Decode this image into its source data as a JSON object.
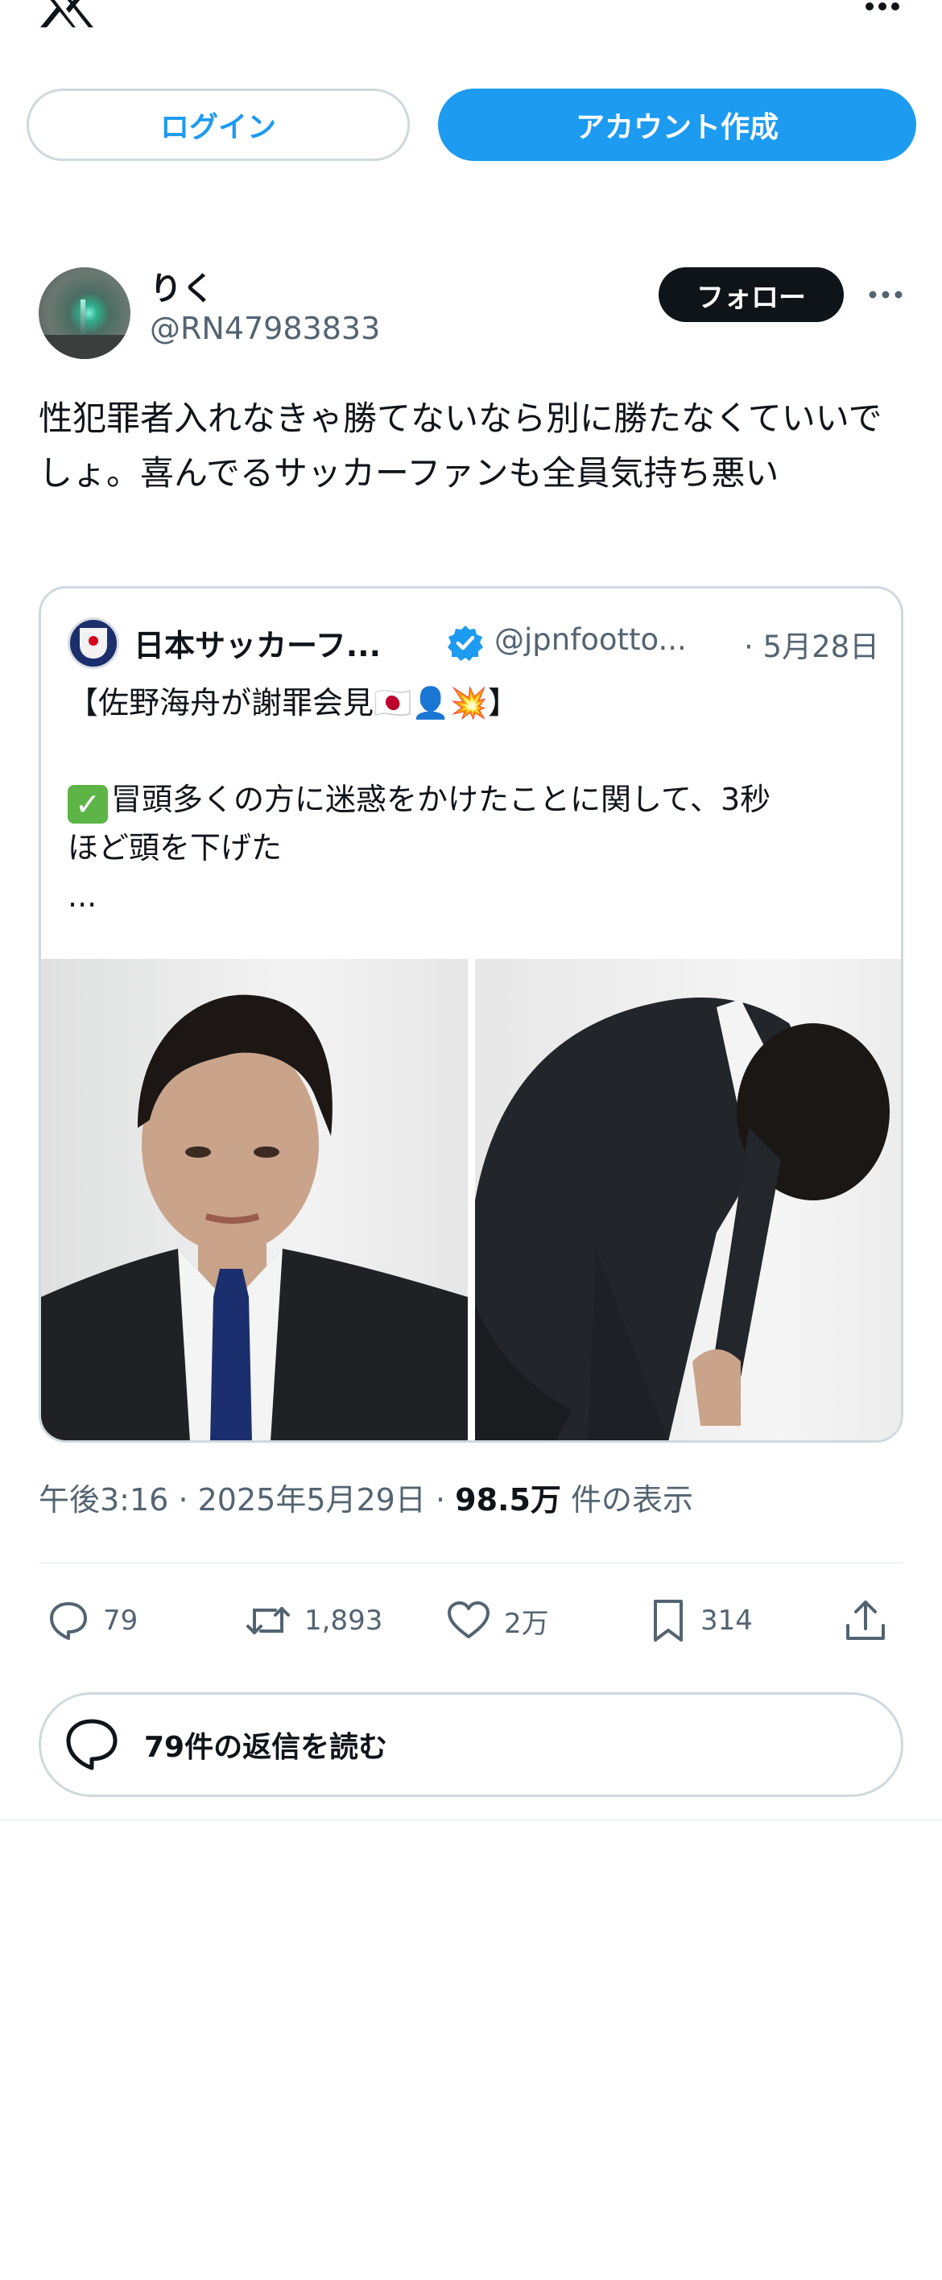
{
  "auth": {
    "login_label": "ログイン",
    "signup_label": "アカウント作成"
  },
  "tweet": {
    "author_name": "りく",
    "author_handle": "@RN47983833",
    "follow_label": "フォロー",
    "text": "性犯罪者入れなきゃ勝てないなら別に勝たなくていいでしょ。喜んでるサッカーファンも全員気持ち悪い",
    "time": "午後3:16",
    "date": "2025年5月29日",
    "views_count": "98.5万",
    "views_label": "件の表示"
  },
  "quote": {
    "author_name": "日本サッカーフ...",
    "author_handle": "@jpnfootto...",
    "date": "· 5月28日",
    "line1": "【佐野海舟が謝罪会見🇯🇵👤💥】",
    "line2_check": "✓",
    "line2": "冒頭多くの方に迷惑をかけたことに関して、3秒",
    "line3": "ほど頭を下げた",
    "line4": "..."
  },
  "actions": {
    "replies": "79",
    "retweets": "1,893",
    "likes": "2万",
    "bookmarks": "314"
  },
  "read_replies_label": "79件の返信を読む",
  "colors": {
    "accent": "#1d9bf0",
    "text_primary": "#0f1419",
    "text_secondary": "#536471",
    "border": "#cfd9de"
  }
}
